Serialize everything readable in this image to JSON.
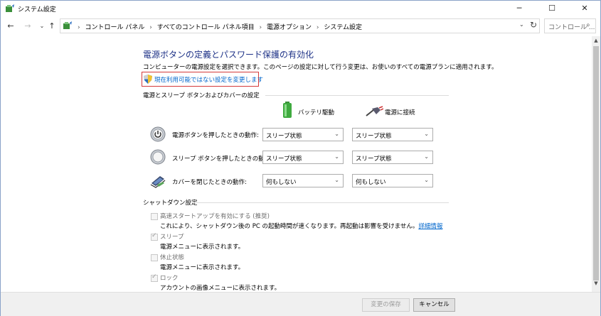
{
  "window": {
    "title": "システム設定",
    "controls": {
      "minimize": "─",
      "maximize": "☐",
      "close": "✕"
    }
  },
  "addressbar": {
    "breadcrumbs": [
      "コントロール パネル",
      "すべてのコントロール パネル項目",
      "電源オプション",
      "システム設定"
    ],
    "search_placeholder": "コントロール ..."
  },
  "main": {
    "heading": "電源ボタンの定義とパスワード保護の有効化",
    "description": "コンピューターの電源設定を選択できます。このページの設定に対して行う変更は、お使いのすべての電源プランに適用されます。",
    "change_link": "現在利用可能ではない設定を変更します",
    "power_section_title": "電源とスリープ ボタンおよびカバーの設定",
    "columns": {
      "battery": "バッテリ駆動",
      "plugged": "電源に接続"
    },
    "rows": [
      {
        "icon": "power-button-icon",
        "label": "電源ボタンを押したときの動作:",
        "battery": "スリープ状態",
        "plugged": "スリープ状態"
      },
      {
        "icon": "sleep-button-icon",
        "label": "スリープ ボタンを押したときの動作:",
        "battery": "スリープ状態",
        "plugged": "スリープ状態"
      },
      {
        "icon": "laptop-lid-icon",
        "label": "カバーを閉じたときの動作:",
        "battery": "何もしない",
        "plugged": "何もしない"
      }
    ],
    "shutdown_section_title": "シャットダウン設定",
    "shutdown_options": [
      {
        "label": "高速スタートアップを有効にする (推奨)",
        "checked": false,
        "description": "これにより、シャットダウン後の PC の起動時間が速くなります。再起動は影響を受けません。",
        "link": "詳細情報"
      },
      {
        "label": "スリープ",
        "checked": true,
        "description": "電源メニューに表示されます。"
      },
      {
        "label": "休止状態",
        "checked": false,
        "description": "電源メニューに表示されます。"
      },
      {
        "label": "ロック",
        "checked": true,
        "description": "アカウントの画像メニューに表示されます。"
      }
    ]
  },
  "footer": {
    "save_label": "変更の保存",
    "cancel_label": "キャンセル"
  }
}
